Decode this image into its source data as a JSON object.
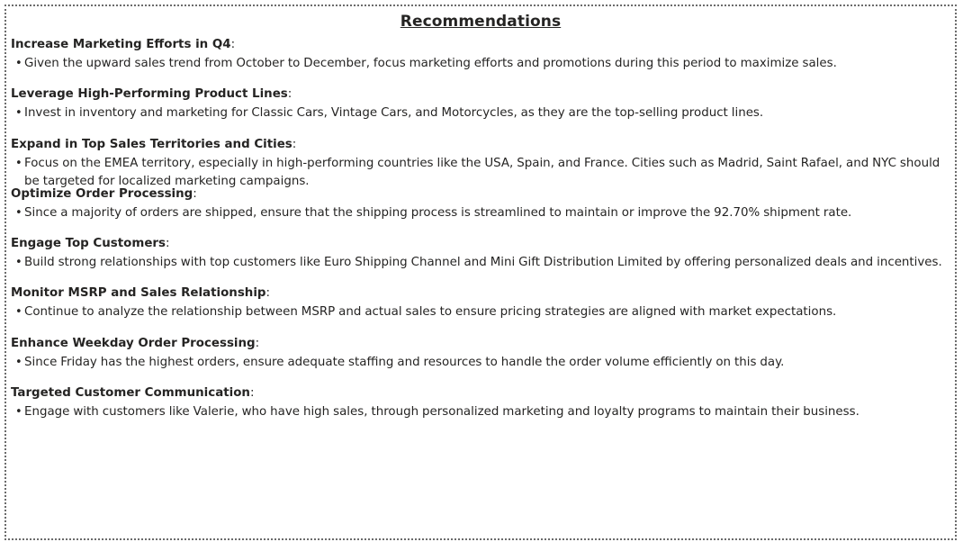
{
  "title": "Recommendations",
  "bullet_glyph": "•",
  "sections": [
    {
      "heading": "Increase Marketing Efforts in Q4",
      "text": "Given the upward sales trend from October to December, focus marketing efforts and promotions during this period to maximize sales."
    },
    {
      "heading": "Leverage High-Performing Product Lines",
      "text": "Invest in inventory and marketing for Classic Cars, Vintage Cars, and Motorcycles, as they are the top-selling product lines."
    },
    {
      "heading": "Expand in Top Sales Territories and Cities",
      "text": "Focus on the EMEA territory, especially in high-performing countries like the USA, Spain, and France. Cities such as Madrid, Saint Rafael, and NYC should be targeted for localized marketing campaigns."
    },
    {
      "heading": "Optimize Order Processing",
      "text": "Since a majority of orders are shipped, ensure that the shipping process is streamlined to maintain or improve the 92.70% shipment rate."
    },
    {
      "heading": "Engage Top Customers",
      "text": "Build strong relationships with top customers like Euro Shipping Channel and Mini Gift Distribution Limited by offering personalized deals and incentives."
    },
    {
      "heading": "Monitor MSRP and Sales Relationship",
      "text": "Continue to analyze the relationship between MSRP and actual sales to ensure pricing strategies are aligned with market expectations."
    },
    {
      "heading": "Enhance Weekday Order Processing",
      "text": "Since Friday has the highest orders, ensure adequate staffing and resources to handle the order volume efficiently on this day."
    },
    {
      "heading": "Targeted Customer Communication",
      "text": "Engage with customers like Valerie, who have high sales, through personalized marketing and loyalty programs to maintain their business."
    }
  ]
}
